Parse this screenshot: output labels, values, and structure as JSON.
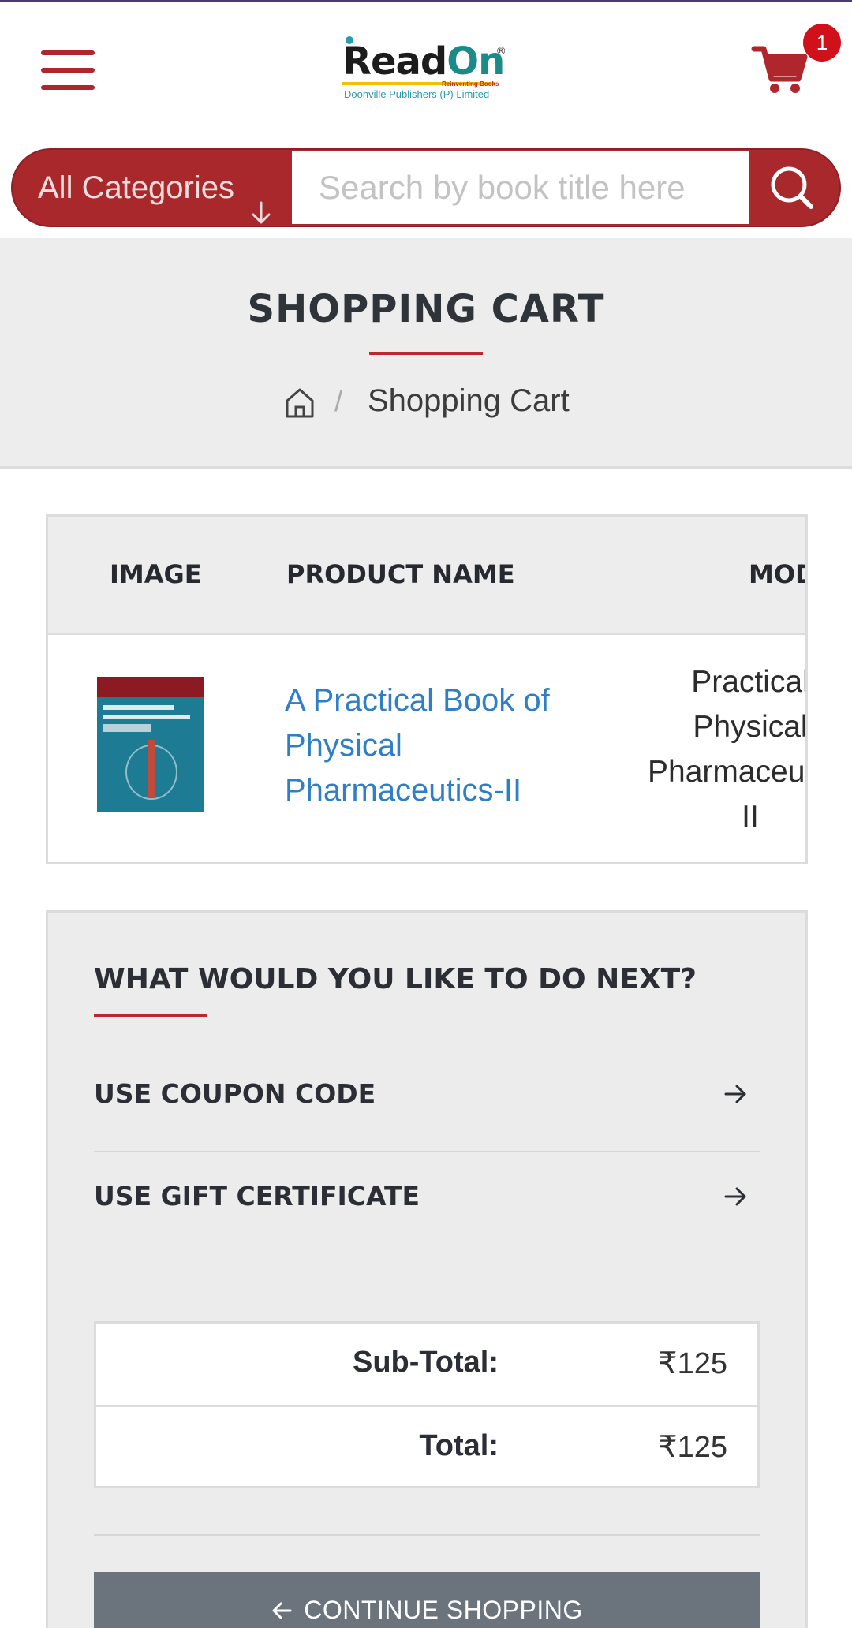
{
  "header": {
    "logo": {
      "wordmark_dark": "Read",
      "wordmark_accent": "On",
      "registered": "®",
      "tagline": "Reinventing Books",
      "publisher": "Doonville Publishers (P) Limited"
    },
    "cart_count": "1",
    "icons": {
      "menu": "hamburger-menu-icon",
      "cart": "shopping-cart-icon"
    }
  },
  "search": {
    "category_label": "All Categories",
    "placeholder": "Search by book title here",
    "value": ""
  },
  "banner": {
    "title": "SHOPPING CART",
    "breadcrumb_separator": "/",
    "breadcrumb_current": "Shopping Cart"
  },
  "cart_table": {
    "headers": {
      "image": "IMAGE",
      "product_name": "PRODUCT NAME",
      "model": "MOD"
    },
    "rows": [
      {
        "product_name": "A Practical Book of Physical Pharmaceutics-II",
        "model": "Practical Physical Pharmaceutics-II",
        "thumbnail_alt": "Physical Pharmaceutics-II cover"
      }
    ]
  },
  "next_actions": {
    "title": "WHAT WOULD YOU LIKE TO DO NEXT?",
    "options": [
      {
        "label": "USE COUPON CODE"
      },
      {
        "label": "USE GIFT CERTIFICATE"
      }
    ]
  },
  "totals": {
    "subtotal_label": "Sub-Total:",
    "subtotal_value": "₹125",
    "total_label": "Total:",
    "total_value": "₹125"
  },
  "continue_button": "CONTINUE SHOPPING",
  "colors": {
    "brand_red": "#b0262d",
    "link_blue": "#2f7fc8",
    "button_gray": "#6b747c"
  }
}
